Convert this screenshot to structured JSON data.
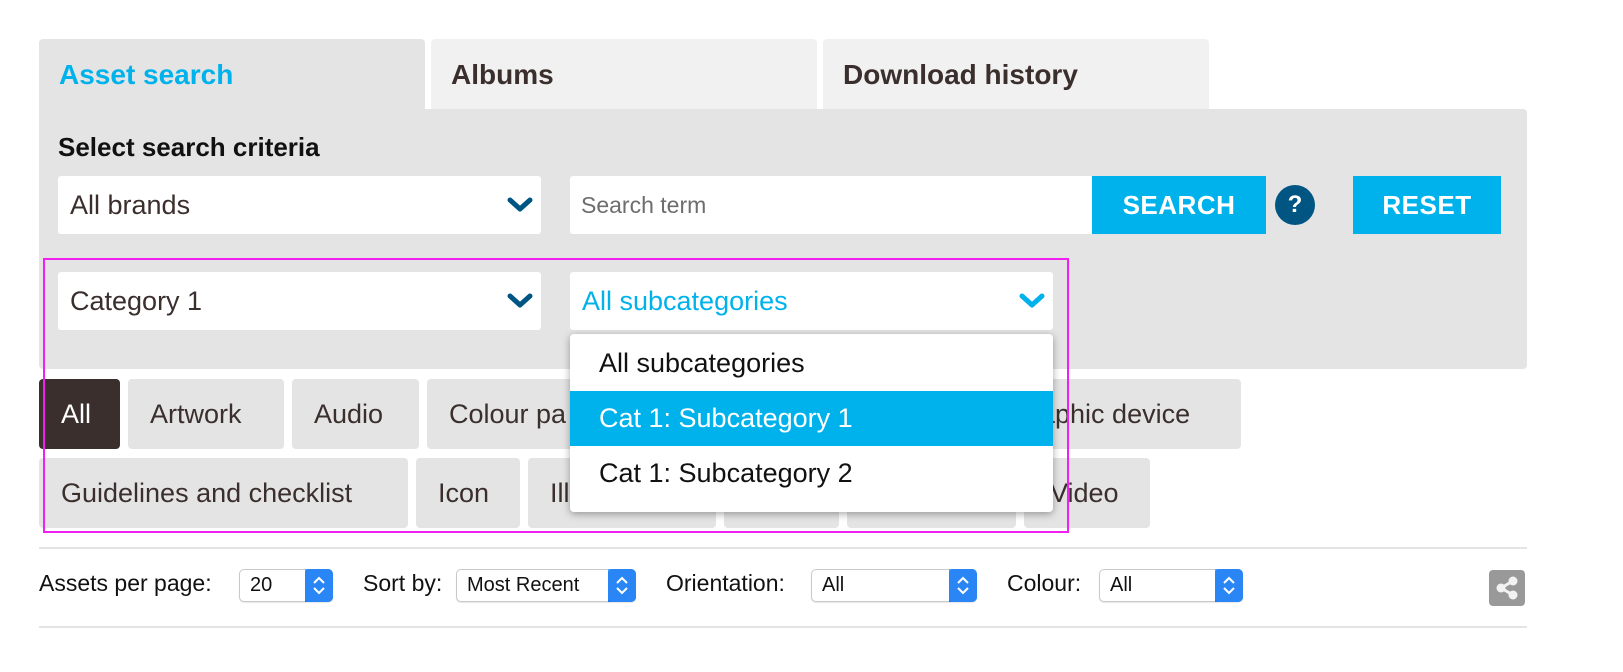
{
  "tabs": [
    {
      "label": "Asset search",
      "active": true
    },
    {
      "label": "Albums",
      "active": false
    },
    {
      "label": "Download history",
      "active": false
    }
  ],
  "search_panel": {
    "title": "Select search criteria",
    "brand_select": {
      "value": "All brands"
    },
    "search_input": {
      "value": "",
      "placeholder": "Search term"
    },
    "search_button": "SEARCH",
    "help_button": "?",
    "reset_button": "RESET",
    "category_select": {
      "value": "Category 1"
    },
    "subcategory_select": {
      "value": "All subcategories"
    }
  },
  "subcategory_dropdown": {
    "options": [
      "All subcategories",
      "Cat 1: Subcategory 1",
      "Cat 1: Subcategory 2"
    ],
    "highlighted_index": 1
  },
  "type_filters": {
    "row1": [
      "All",
      "Artwork",
      "Audio",
      "Colour pa",
      "aphic device"
    ],
    "row2": [
      "Guidelines and checklist",
      "Icon",
      "Ill",
      "",
      "",
      "Video"
    ],
    "active": "All"
  },
  "results_bar": {
    "assets_per_page": {
      "label": "Assets per page:",
      "value": "20"
    },
    "sort_by": {
      "label": "Sort by:",
      "value": "Most Recent"
    },
    "orientation": {
      "label": "Orientation:",
      "value": "All"
    },
    "colour": {
      "label": "Colour:",
      "value": "All"
    },
    "share_icon": "share-icon"
  },
  "colors": {
    "accent": "#00b2ec",
    "help": "#005583",
    "dark": "#3a2f2d",
    "panel": "#e4e4e4"
  }
}
